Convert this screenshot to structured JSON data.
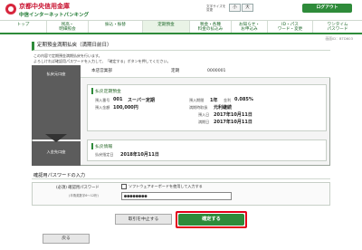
{
  "header": {
    "bank_name": "京都中央信用金庫",
    "service_name": "中信インターネットバンキング",
    "fontsize_label": "文字サイズを変更",
    "fontsize_small": "小",
    "fontsize_large": "大",
    "logout_label": "ログアウト"
  },
  "nav": {
    "items": [
      {
        "label": "トップ"
      },
      {
        "label": "残高・\n明細照会"
      },
      {
        "label": "振込・振替"
      },
      {
        "label": "定期預金"
      },
      {
        "label": "税金・各種\n料金の払込み"
      },
      {
        "label": "お知らせ・\nお申込み"
      },
      {
        "label": "ID・パス\nワード・変更"
      },
      {
        "label": "ワンタイム\nパスワード"
      }
    ]
  },
  "page_id": "画面ID：BTD603",
  "title": "定期預金満期払戻（満期日前日）",
  "desc_lines": [
    "この内容で定期預金満期払戻を行います。",
    "よろしければ確認用パスワードを入力して、「確定する」ボタンを押してください。"
  ],
  "from": {
    "side_label": "払戻元口座",
    "account": {
      "branch": "本店営業部",
      "type": "定期",
      "number": "0000001"
    },
    "box_title": "払戻定期預金",
    "fields": {
      "deposit_no_label": "預入番号",
      "deposit_no": "001",
      "product": "スーパー定期",
      "period_label": "預入期間",
      "period": "1年",
      "rate_label": "金利",
      "rate": "0.085%",
      "amount_label": "預入金額",
      "amount": "100,000円",
      "maturity_method_label": "満期時取扱",
      "maturity_method": "元利継続",
      "deposit_date_label": "預入日",
      "deposit_date": "2017年10月11日",
      "maturity_date_label": "満期日",
      "maturity_date": "2017年10月11日"
    }
  },
  "to": {
    "side_label": "入金先口座",
    "box_title": "払戻情報",
    "date_label": "払戻指定日",
    "date": "2018年10月11日"
  },
  "password": {
    "section_title": "確認用パスワードの入力",
    "label": "(必須) 確認用パスワード",
    "note": "(半角英数字6〜12桁)",
    "checkbox_label": "ソフトウェアキーボードを使用して入力する",
    "value": "●●●●●●●●"
  },
  "buttons": {
    "stop": "取引を中止する",
    "confirm": "確定する",
    "back": "戻る"
  },
  "colors": {
    "accent": "#2e8b3a",
    "brand_red": "#c8102e",
    "highlight": "#e2001a"
  }
}
